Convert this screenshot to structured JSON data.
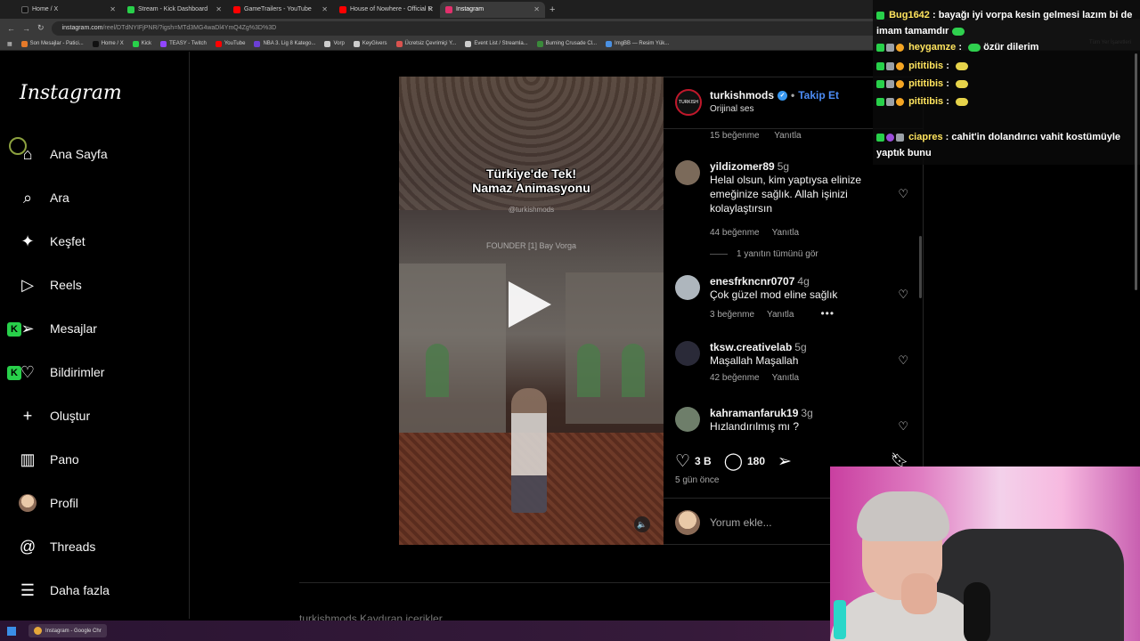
{
  "browser": {
    "tabs": [
      {
        "label": "Home / X",
        "color": "#111111",
        "active": false
      },
      {
        "label": "Stream - Kick Dashboard",
        "color": "#28d04a",
        "active": false
      },
      {
        "label": "GameTrailers - YouTube",
        "color": "#ff0000",
        "active": false
      },
      {
        "label": "House of Nowhere - Official R",
        "color": "#ff0000",
        "active": false
      },
      {
        "label": "Instagram",
        "color": "#e1306c",
        "active": true
      }
    ],
    "url_host": "instagram.com",
    "url_path": "/reel/DTdNYIFjPNR/?igsh=MTd3MG4waDl4YmQ4Zg%3D%3D",
    "bookmarks": [
      "Son Mesajlar - Patici...",
      "Home / X",
      "Kick",
      "TEASY - Twitch",
      "YouTube",
      "NBA 3. Lig 8 Katego...",
      "Vorp",
      "KeyGivers",
      "Ücretsiz Çevrimiçi Y...",
      "Event List / Streamla...",
      "Burning Crusade Cl...",
      "ImgBB — Resim Yük..."
    ],
    "bookmark_colors": [
      "#e57a2a",
      "#111111",
      "#28d04a",
      "#9146ff",
      "#ff0000",
      "#6b3fd6",
      "#cccccc",
      "#cccccc",
      "#d9534f",
      "#cccccc",
      "#3a8a3a",
      "#4a90e2"
    ],
    "bookmarks_right": "Tüm Yer İşaretleri"
  },
  "sidebar": {
    "logo": "Instagram",
    "items": [
      {
        "label": "Ana Sayfa",
        "icon": "home-icon",
        "glyph": "⌂"
      },
      {
        "label": "Ara",
        "icon": "search-icon",
        "glyph": "⌕"
      },
      {
        "label": "Keşfet",
        "icon": "compass-icon",
        "glyph": "✦"
      },
      {
        "label": "Reels",
        "icon": "reels-icon",
        "glyph": "▷"
      },
      {
        "label": "Mesajlar",
        "icon": "messages-icon",
        "glyph": "➢"
      },
      {
        "label": "Bildirimler",
        "icon": "heart-icon",
        "glyph": "♡"
      },
      {
        "label": "Oluştur",
        "icon": "plus-icon",
        "glyph": "+"
      },
      {
        "label": "Pano",
        "icon": "dashboard-icon",
        "glyph": "▥"
      },
      {
        "label": "Profil",
        "icon": "profile-avatar",
        "glyph": ""
      },
      {
        "label": "Threads",
        "icon": "threads-icon",
        "glyph": "@"
      },
      {
        "label": "Daha fazla",
        "icon": "menu-icon",
        "glyph": "☰"
      }
    ]
  },
  "video": {
    "title_line1": "Türkiye'de Tek!",
    "title_line2": "Namaz Animasyonu",
    "watermark": "@turkishmods",
    "founder_text": "FOUNDER [1] Bay Vorga"
  },
  "post": {
    "username": "turkishmods",
    "follow": "Takip Et",
    "audio": "Orijinal ses",
    "avatar_text": "TURKISH",
    "top_meta": {
      "likes": "15 beğenme",
      "reply": "Yanıtla"
    },
    "comments": [
      {
        "user": "yildizomer89",
        "time": "5g",
        "text": "Helal olsun, kim yaptıysa elinize emeğinize sağlık. Allah işinizi kolaylaştırsın",
        "likes": "44 beğenme",
        "reply": "Yanıtla",
        "avatar_color": "#7b6a5a"
      },
      {
        "user": "enesfrkncnr0707",
        "time": "4g",
        "text": "Çok güzel mod eline sağlık",
        "likes": "3 beğenme",
        "reply": "Yanıtla",
        "avatar_color": "#aeb6bd"
      },
      {
        "user": "tksw.creativelab",
        "time": "5g",
        "text": "Maşallah Maşallah",
        "likes": "42 beğenme",
        "reply": "Yanıtla",
        "avatar_color": "#2a2a38"
      },
      {
        "user": "kahramanfaruk19",
        "time": "3g",
        "text": "Hızlandırılmış mı ?",
        "likes": "",
        "reply": "",
        "avatar_color": "#6e7e6a"
      }
    ],
    "view_replies": "1 yanıtın tümünü gör",
    "like_count": "3 B",
    "comment_count": "180",
    "posted_ago": "5 gün önce",
    "comment_placeholder": "Yorum ekle..."
  },
  "below": {
    "text": "turkishmods Kaydıran içerikler"
  },
  "taskbar": {
    "item": "Instagram - Google Chr"
  },
  "chat": {
    "messages": [
      {
        "user": "Bug1642",
        "text": "bayağı iyi vorpa kesin gelmesi lazım bi de imam tamamdır"
      },
      {
        "user": "heygamze",
        "text": "özür dilerim"
      },
      {
        "user": "pititibis",
        "text": ""
      },
      {
        "user": "pititibis",
        "text": ""
      },
      {
        "user": "pititibis",
        "text": ""
      },
      {
        "user": "ciapres",
        "text": "cahit'in dolandırıcı vahit kostümüyle yaptık bunu"
      }
    ]
  }
}
